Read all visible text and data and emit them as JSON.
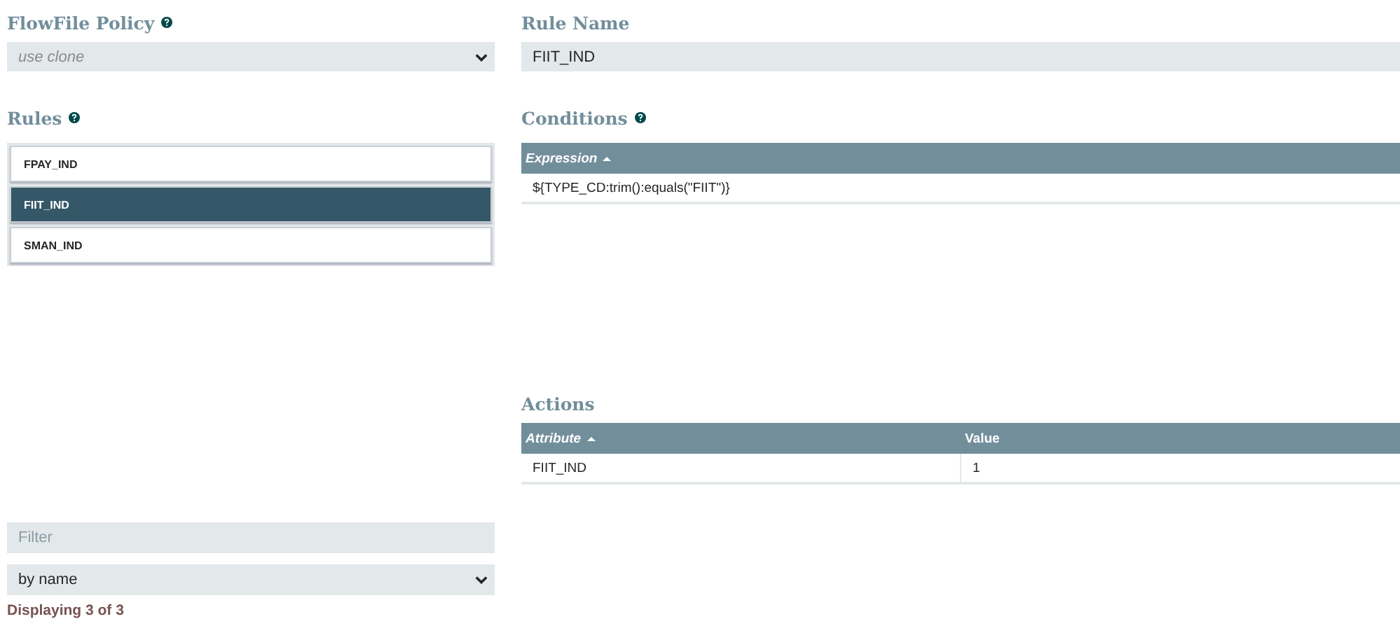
{
  "flowfile_policy": {
    "label": "FlowFile Policy",
    "value": "use clone"
  },
  "rules": {
    "label": "Rules",
    "items": [
      {
        "name": "FPAY_IND",
        "selected": false
      },
      {
        "name": "FIIT_IND",
        "selected": true
      },
      {
        "name": "SMAN_IND",
        "selected": false
      }
    ]
  },
  "filter": {
    "placeholder": "Filter",
    "sort": "by name",
    "status": "Displaying 3 of 3"
  },
  "rule_name": {
    "label": "Rule Name",
    "value": "FIIT_IND"
  },
  "conditions": {
    "label": "Conditions",
    "columns": [
      "Expression"
    ],
    "rows": [
      [
        "${TYPE_CD:trim():equals(\"FIIT\")}"
      ]
    ]
  },
  "actions": {
    "label": "Actions",
    "columns": [
      "Attribute",
      "Value"
    ],
    "rows": [
      [
        "FIIT_IND",
        "1"
      ]
    ]
  }
}
